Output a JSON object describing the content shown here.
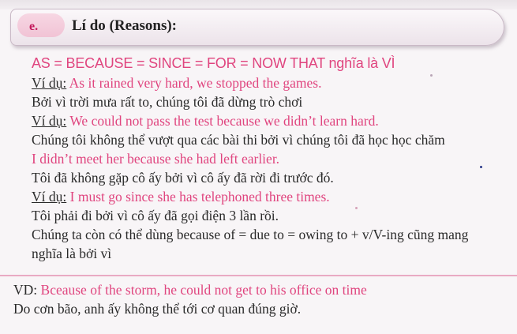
{
  "header": {
    "letter": "e.",
    "title": "Lí do (Reasons):"
  },
  "main": {
    "heading": "AS = BECAUSE = SINCE = FOR = NOW THAT nghĩa là VÌ",
    "lines": [
      {
        "label": "Ví dụ:",
        "text": "As it rained very hard, we stopped the games."
      },
      {
        "text": "Bởi vì trời mưa rất to, chúng tôi đã dừng trò chơi"
      },
      {
        "label": "Ví dụ:",
        "text": "We could not pass the test because we didn’t learn hard."
      },
      {
        "text": "Chúng tôi không thể vượt qua các bài thi bởi vì chúng tôi đã học học chăm"
      },
      {
        "text": "I didn’t meet her because she had left earlier."
      },
      {
        "text": "Tôi đã không gặp cô ấy bởi vì cô ấy đã rời đi trước đó."
      },
      {
        "label": "Ví dụ:",
        "text": "I must go since she has telephoned three times."
      },
      {
        "text": "Tôi phải đi bởi vì cô ấy đã gọi điện 3 lần rồi."
      },
      {
        "text": "Chúng ta còn có thể dùng because of = due to = owing to + v/V-ing cũng mang"
      },
      {
        "text": "nghĩa là bởi vì"
      }
    ]
  },
  "vd": {
    "label": "VD:",
    "text": "Bceause of the storm, he could not get to his office on time",
    "translation": "Do cơn bão, anh ấy không thể tới cơ quan đúng giờ."
  },
  "colors": {
    "accent": "#e0457f",
    "header_letter": "#c2185b",
    "rule": "#e9aac3"
  }
}
